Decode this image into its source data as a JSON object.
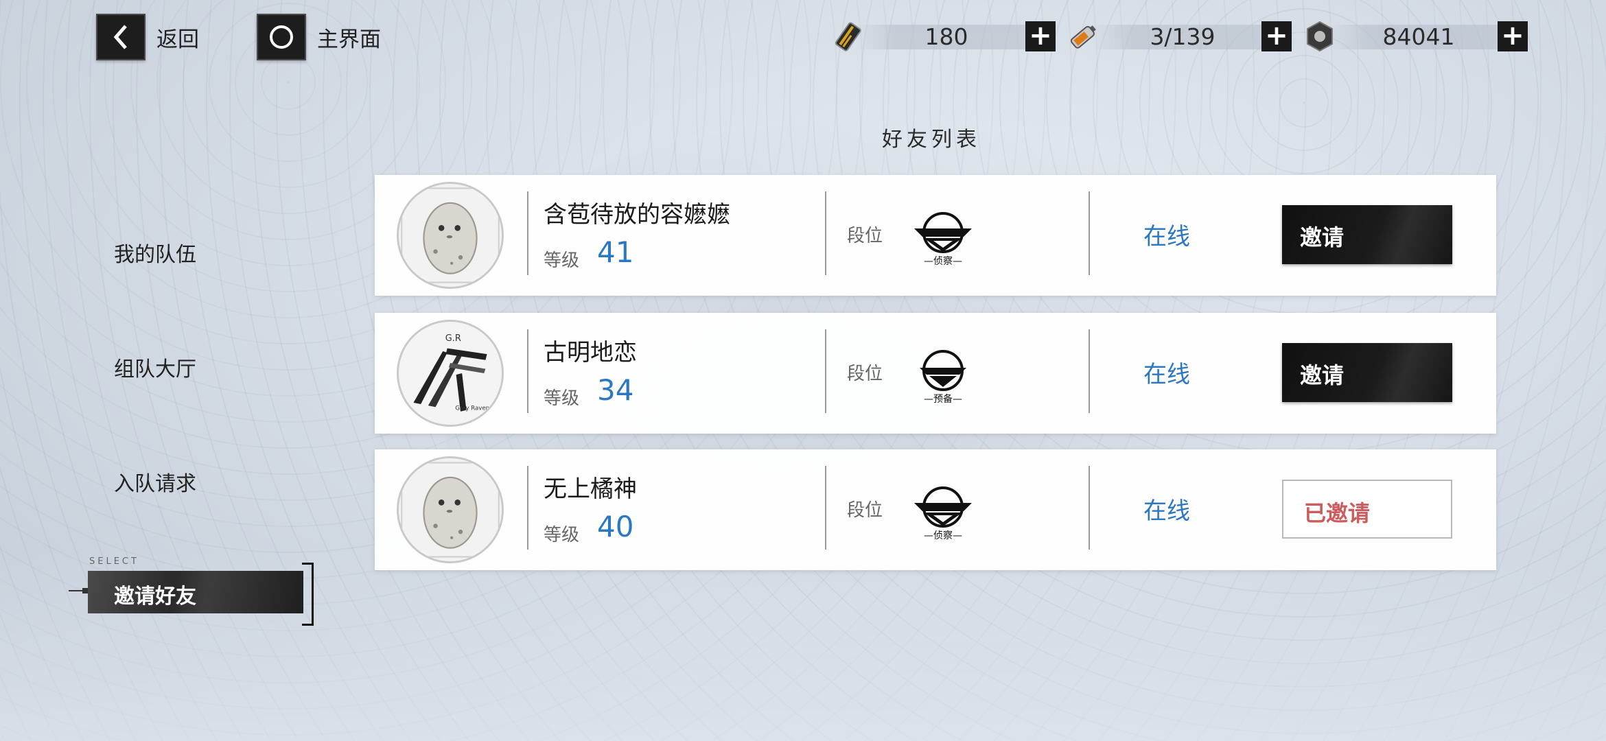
{
  "nav": {
    "back_label": "返回",
    "home_label": "主界面"
  },
  "resources": [
    {
      "icon": "ticket-icon",
      "value": "180"
    },
    {
      "icon": "battery-icon",
      "value": "3/139"
    },
    {
      "icon": "hex-nut-icon",
      "value": "84041"
    }
  ],
  "list_title": "好友列表",
  "sidebar": {
    "items": [
      {
        "label": "我的队伍"
      },
      {
        "label": "组队大厅"
      },
      {
        "label": "入队请求"
      },
      {
        "label": "邀请好友"
      }
    ],
    "select_tag": "SELECT",
    "selected_index": 3
  },
  "friends": [
    {
      "name": "含苞待放的容嬷嬷",
      "level_label": "等级",
      "level": "41",
      "rank_label": "段位",
      "rank_name": "侦察",
      "status": "在线",
      "action": "邀请",
      "avatar": "potato-avatar"
    },
    {
      "name": "古明地恋",
      "level_label": "等级",
      "level": "34",
      "rank_label": "段位",
      "rank_name": "预备",
      "status": "在线",
      "action": "邀请",
      "avatar": "gr-logo-avatar"
    },
    {
      "name": "无上橘神",
      "level_label": "等级",
      "level": "40",
      "rank_label": "段位",
      "rank_name": "侦察",
      "status": "在线",
      "action": "已邀请",
      "avatar": "potato-avatar"
    }
  ],
  "colors": {
    "accent_blue": "#2a78c4",
    "invited_red": "#c84a4a",
    "button_black": "#111111"
  }
}
